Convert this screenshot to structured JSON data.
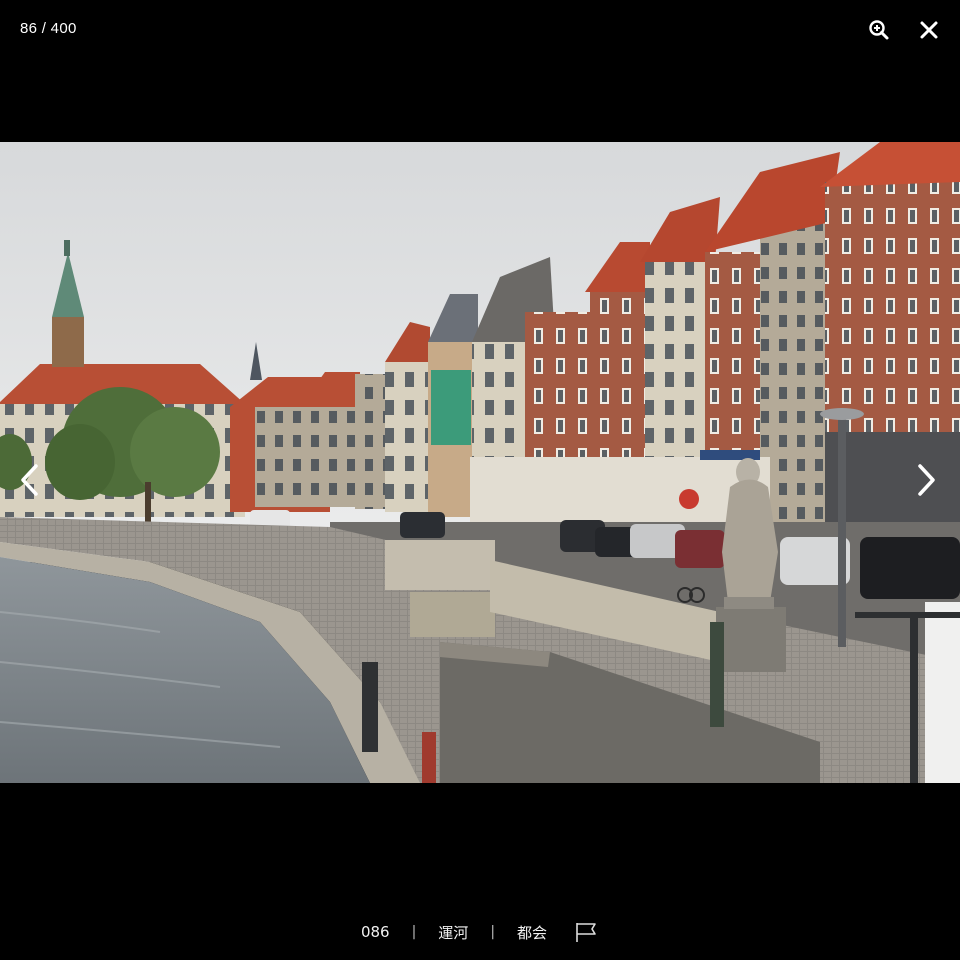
{
  "viewer": {
    "counter": "86 / 400"
  },
  "caption": {
    "number": "086",
    "separator": "|",
    "tag_1": "運河",
    "tag_2": "都会"
  },
  "icons": {
    "zoom": "zoom-in-icon",
    "close": "close-icon",
    "prev": "chevron-left-icon",
    "next": "chevron-right-icon",
    "report": "flag-icon"
  },
  "colors": {
    "background": "#000000",
    "text": "#ffffff"
  }
}
